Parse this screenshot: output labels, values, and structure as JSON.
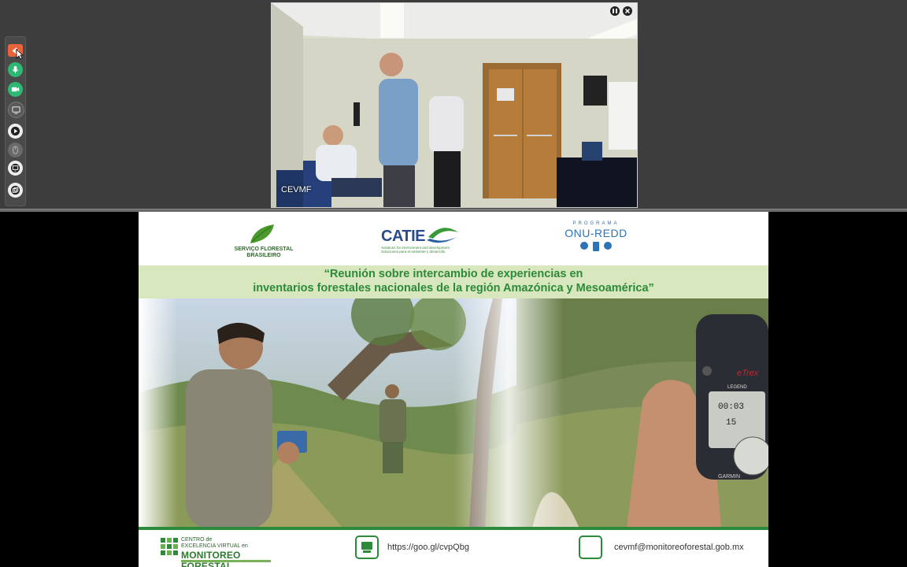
{
  "video": {
    "participant_label": "CEVMF",
    "pause_icon": "pause-icon",
    "close_icon": "close-icon"
  },
  "toolbar": {
    "items": [
      {
        "name": "back-arrow-icon",
        "color": "#e8643a"
      },
      {
        "name": "microphone-icon",
        "color": "#2eb872"
      },
      {
        "name": "camera-icon",
        "color": "#2eb872"
      },
      {
        "name": "screen-share-icon",
        "color": "#5a5a5a"
      },
      {
        "name": "play-icon",
        "color": "#ededed"
      },
      {
        "name": "mouse-icon",
        "color": "#6a6a6a"
      },
      {
        "name": "presentation-icon",
        "color": "#ededed"
      },
      {
        "name": "copy-windows-icon",
        "color": "#ededed"
      }
    ]
  },
  "slide": {
    "logos": {
      "sfb": "SERVIÇO FLORESTAL BRASILEIRO",
      "catie_name": "CATIE",
      "catie_sub": "Solutions for environment and development · Soluciones para el ambiente y desarrollo",
      "onu_program": "PROGRAMA",
      "onu_name": "ONU-REDD"
    },
    "title_line_1": "“Reunión sobre intercambio de experiencias en",
    "title_line_2": "inventarios forestales nacionales de la región Amazónica y Mesoamérica”",
    "gps_model": "eTrex",
    "gps_brand": "LEGEND",
    "gps_maker": "GARMIN",
    "gps_time": "00:03",
    "gps_value": "15",
    "footer": {
      "logo_line_1": "CENTRO de",
      "logo_line_2": "EXCELENCIA VIRTUAL en",
      "logo_line_3": "MONITOREO FORESTAL",
      "url": "https://goo.gl/cvpQbg",
      "email": "cevmf@monitoreoforestal.gob.mx"
    },
    "colors": {
      "accent_green": "#2c8a3a",
      "title_band": "#d8e7bd"
    }
  }
}
